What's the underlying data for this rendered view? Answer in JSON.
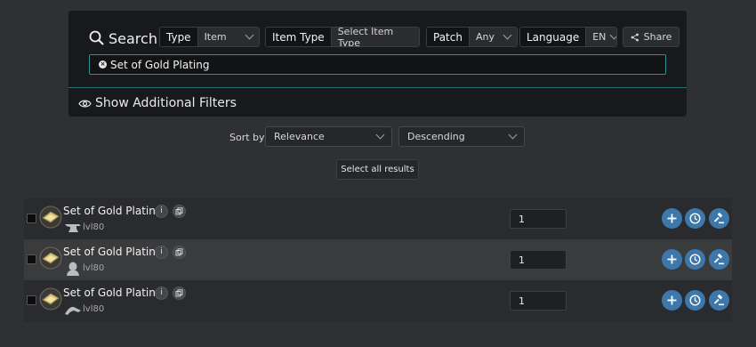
{
  "search": {
    "title": "Search",
    "type": {
      "label": "Type",
      "value": "Item"
    },
    "item_type": {
      "label": "Item Type",
      "value": "Select Item Type"
    },
    "patch": {
      "label": "Patch",
      "value": "Any"
    },
    "language": {
      "label": "Language",
      "value": "EN"
    },
    "share_label": "Share",
    "query": "Set of Gold Plating"
  },
  "filters": {
    "show_label": "Show Additional Filters"
  },
  "sort": {
    "label": "Sort by:",
    "field": "Relevance",
    "order": "Descending"
  },
  "select_all_label": "Select all results",
  "results": [
    {
      "name": "Set of Gold Plating",
      "level": "lvl80",
      "quantity": "1",
      "job_icon": "anvil-icon"
    },
    {
      "name": "Set of Gold Plating",
      "level": "lvl80",
      "quantity": "1",
      "job_icon": "bust-icon"
    },
    {
      "name": "Set of Gold Plating",
      "level": "lvl80",
      "quantity": "1",
      "job_icon": "hammer-icon"
    }
  ],
  "colors": {
    "accent": "#2e8f94",
    "button": "#3e78ab",
    "panel": "#17191c",
    "background": "#2f3033"
  }
}
